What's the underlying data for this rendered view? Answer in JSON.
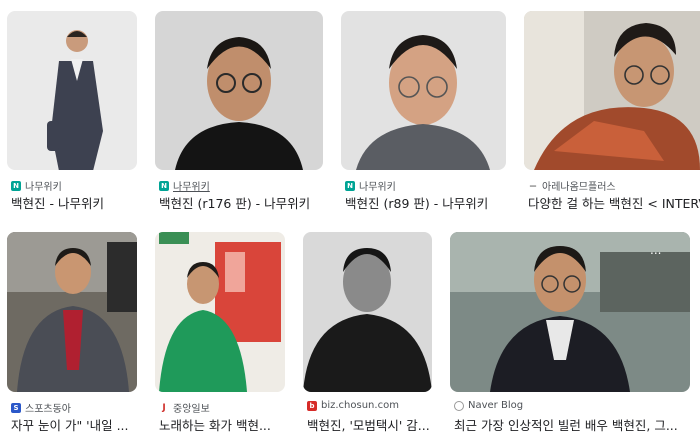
{
  "colors": {
    "namuwiki": "#00a495",
    "sportsdonga": "#2b58c9",
    "joongang": "#d0312d",
    "chosun": "#d62b28",
    "naverblog": "#ffffff"
  },
  "results": [
    {
      "source": "나무위키",
      "source_icon": "namuwiki-favicon",
      "title": "백현진 - 나무위키"
    },
    {
      "source": "나무위키",
      "source_icon": "namuwiki-favicon",
      "title": "백현진 (r176 판) - 나무위키"
    },
    {
      "source": "나무위키",
      "source_icon": "namuwiki-favicon",
      "title": "백현진 (r89 판) - 나무위키"
    },
    {
      "source": "아레나옴므플러스",
      "source_icon": "arena-favicon",
      "title": "다양한 걸 하는 백현진 < INTERVIEW"
    },
    {
      "source": "스포츠동아",
      "source_icon": "sportsdonga-favicon",
      "title": "자꾸 눈이 가\" '내일 ..."
    },
    {
      "source": "중앙일보",
      "source_icon": "joongang-favicon",
      "title": "노래하는 화가 백현..."
    },
    {
      "source": "biz.chosun.com",
      "source_icon": "chosun-favicon",
      "title": "백현진, '모범택시' 감..."
    },
    {
      "source": "Naver Blog",
      "source_icon": "naverblog-favicon",
      "title": "최근 가장 인상적인 빌런 배우 백현진, 그..."
    }
  ]
}
